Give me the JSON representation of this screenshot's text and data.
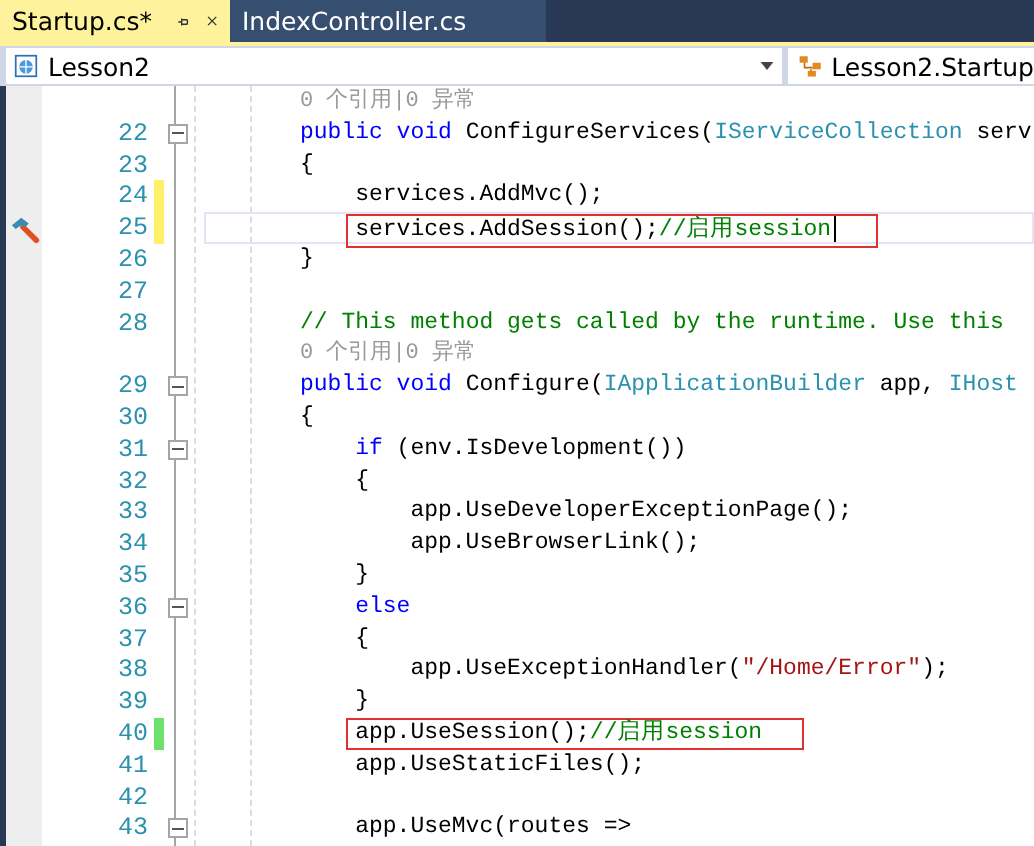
{
  "tabs": [
    {
      "label": "Startup.cs*",
      "selected": true
    },
    {
      "label": "IndexController.cs",
      "selected": false
    }
  ],
  "nav": {
    "project": "Lesson2",
    "class": "Lesson2.Startup"
  },
  "lines": [
    {
      "kind": "lens",
      "text": "0 个引用|0 异常"
    },
    {
      "kind": "code",
      "number": "22",
      "fold": true,
      "tokens": [
        {
          "kind": "kw",
          "s": "public void "
        },
        {
          "kind": "plain",
          "s": "ConfigureServices("
        },
        {
          "kind": "type",
          "s": "IServiceCollection"
        },
        {
          "kind": "plain",
          "s": " serv"
        }
      ]
    },
    {
      "kind": "code",
      "number": "23",
      "tokens": [
        {
          "kind": "plain",
          "s": "{"
        }
      ],
      "children": [
        {
          "kind": "code",
          "number": "24",
          "change": {
            "color": "#fff06a"
          },
          "tokens": [
            {
              "kind": "plain",
              "s": "services.AddMvc();"
            }
          ]
        },
        {
          "kind": "code",
          "number": "25",
          "change": {
            "color": "#fff06a"
          },
          "current": true,
          "boxed": true,
          "hammer": true,
          "tokens": [
            {
              "kind": "plain",
              "s": "services.AddSession();"
            },
            {
              "kind": "comment",
              "s": "//启用session"
            }
          ]
        }
      ]
    },
    {
      "kind": "code",
      "number": "26",
      "tokens": [
        {
          "kind": "plain",
          "s": "}"
        }
      ]
    },
    {
      "kind": "code",
      "number": "27"
    },
    {
      "kind": "code",
      "number": "28",
      "tokens": [
        {
          "kind": "comment",
          "s": "// This method gets called by the runtime. Use this"
        }
      ]
    },
    {
      "kind": "lens",
      "text": "0 个引用|0 异常"
    },
    {
      "kind": "code",
      "number": "29",
      "fold": true,
      "tokens": [
        {
          "kind": "kw",
          "s": "public void "
        },
        {
          "kind": "plain",
          "s": "Configure("
        },
        {
          "kind": "type",
          "s": "IApplicationBuilder"
        },
        {
          "kind": "plain",
          "s": " app, "
        },
        {
          "kind": "type",
          "s": "IHost"
        }
      ]
    },
    {
      "kind": "code",
      "number": "30",
      "tokens": [
        {
          "kind": "plain",
          "s": "{"
        }
      ],
      "children": [
        {
          "kind": "code",
          "number": "31",
          "fold": true,
          "tokens": [
            {
              "kind": "kw",
              "s": "if"
            },
            {
              "kind": "plain",
              "s": " (env.IsDevelopment())"
            }
          ]
        },
        {
          "kind": "code",
          "number": "32",
          "tokens": [
            {
              "kind": "plain",
              "s": "{"
            }
          ],
          "children": [
            {
              "kind": "code",
              "number": "33",
              "tokens": [
                {
                  "kind": "plain",
                  "s": "app.UseDeveloperExceptionPage();"
                }
              ]
            },
            {
              "kind": "code",
              "number": "34",
              "tokens": [
                {
                  "kind": "plain",
                  "s": "app.UseBrowserLink();"
                }
              ]
            }
          ]
        },
        {
          "kind": "code",
          "number": "35",
          "tokens": [
            {
              "kind": "plain",
              "s": "}"
            }
          ]
        },
        {
          "kind": "code",
          "number": "36",
          "fold": true,
          "tokens": [
            {
              "kind": "kw",
              "s": "else"
            }
          ]
        },
        {
          "kind": "code",
          "number": "37",
          "tokens": [
            {
              "kind": "plain",
              "s": "{"
            }
          ],
          "children": [
            {
              "kind": "code",
              "number": "38",
              "tokens": [
                {
                  "kind": "plain",
                  "s": "app.UseExceptionHandler("
                },
                {
                  "kind": "string",
                  "s": "\"/Home/Error\""
                },
                {
                  "kind": "plain",
                  "s": ");"
                }
              ]
            }
          ]
        },
        {
          "kind": "code",
          "number": "39",
          "tokens": [
            {
              "kind": "plain",
              "s": "}"
            }
          ]
        },
        {
          "kind": "code",
          "number": "40",
          "change": {
            "color": "#6ce26c"
          },
          "boxed": true,
          "tokens": [
            {
              "kind": "plain",
              "s": "app.UseSession();"
            },
            {
              "kind": "comment",
              "s": "//启用session"
            }
          ]
        },
        {
          "kind": "code",
          "number": "41",
          "tokens": [
            {
              "kind": "plain",
              "s": "app.UseStaticFiles();"
            }
          ]
        },
        {
          "kind": "code",
          "number": "42"
        },
        {
          "kind": "code",
          "number": "43",
          "fold": true,
          "tokens": [
            {
              "kind": "plain",
              "s": "app.UseMvc(routes =>"
            }
          ]
        }
      ]
    }
  ]
}
